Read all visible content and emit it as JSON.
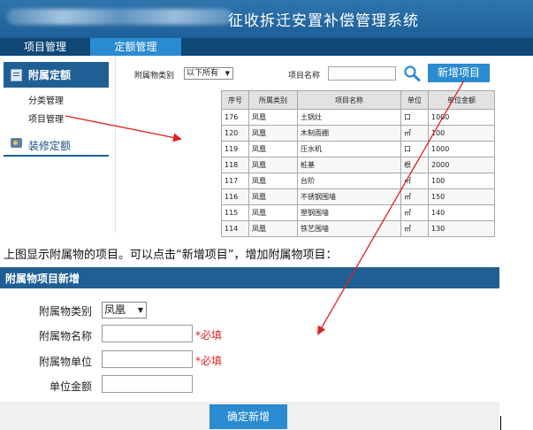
{
  "header": {
    "system_title": "征收拆迁安置补偿管理系统"
  },
  "nav": {
    "tabs": [
      {
        "label": "项目管理"
      },
      {
        "label": "定额管理"
      }
    ]
  },
  "sidebar": {
    "section1_title": "附属定额",
    "items": [
      {
        "label": "分类管理"
      },
      {
        "label": "项目管理"
      }
    ],
    "section2_title": "装修定额"
  },
  "filter": {
    "category_label": "附属物类别",
    "category_value": "以下所有",
    "name_label": "项目名称",
    "name_value": "",
    "add_button": "新增项目"
  },
  "table": {
    "headers": [
      "序号",
      "所属类别",
      "项目名称",
      "单位",
      "单位金额"
    ],
    "rows": [
      [
        "176",
        "凤凰",
        "土锅灶",
        "口",
        "1000"
      ],
      [
        "120",
        "凤凰",
        "木制雨棚",
        "㎡",
        "100"
      ],
      [
        "119",
        "凤凰",
        "压水机",
        "口",
        "1000"
      ],
      [
        "118",
        "凤凰",
        "桩基",
        "根",
        "2000"
      ],
      [
        "117",
        "凤凰",
        "台阶",
        "㎡",
        "100"
      ],
      [
        "116",
        "凤凰",
        "不锈钢围墙",
        "㎡",
        "150"
      ],
      [
        "115",
        "凤凰",
        "塑钢围墙",
        "㎡",
        "140"
      ],
      [
        "114",
        "凤凰",
        "铁艺围墙",
        "㎡",
        "130"
      ]
    ]
  },
  "description": "上图显示附属物的项目。可以点击“新增项目”，增加附属物项目：",
  "form": {
    "title": "附属物项目新增",
    "type_label": "附属物类别",
    "type_value": "凤凰",
    "name_label": "附属物名称",
    "unit_label": "附属物单位",
    "amount_label": "单位金额",
    "required": "*必填",
    "submit": "确定新增"
  },
  "colors": {
    "header_blue": "#1d5f98",
    "accent_blue": "#2b8bd0",
    "annotation_red": "#e02020"
  }
}
